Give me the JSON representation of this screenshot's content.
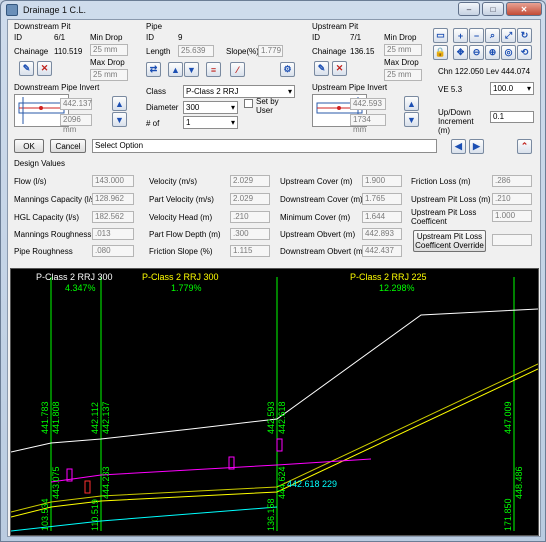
{
  "window": {
    "title": "Drainage 1 C.L."
  },
  "downstream_pit": {
    "heading": "Downstream Pit",
    "id_label": "ID",
    "id_value": "6/1",
    "chainage_label": "Chainage",
    "chainage_value": "110.519",
    "min_drop_label": "Min Drop",
    "min_drop_value": "25 mm",
    "max_drop_label": "Max Drop",
    "max_drop_value": "25 mm",
    "invert_heading": "Downstream Pipe Invert",
    "invert_value": "442.137",
    "invert_mm": "2096 mm"
  },
  "pipe": {
    "heading": "Pipe",
    "id_label": "ID",
    "id_value": "9",
    "length_label": "Length",
    "length_value": "25.639",
    "slope_label": "Slope(%)",
    "slope_value": "1.779",
    "class_label": "Class",
    "class_value": "P-Class 2 RRJ",
    "diameter_label": "Diameter",
    "diameter_value": "300",
    "setby_label": "Set by User",
    "count_label": "# of",
    "count_value": "1"
  },
  "upstream_pit": {
    "heading": "Upstream Pit",
    "id_label": "ID",
    "id_value": "7/1",
    "chainage_label": "Chainage",
    "chainage_value": "136.15",
    "min_drop_label": "Min Drop",
    "min_drop_value": "25 mm",
    "max_drop_label": "Max Drop",
    "max_drop_value": "25 mm",
    "invert_heading": "Upstream Pipe Invert",
    "invert_value": "442.593",
    "invert_mm": "1734 mm"
  },
  "view": {
    "chn_lev": "Chn 122.050 Lev 444.074",
    "ve_label": "VE 5.3",
    "ve_value": "100.0",
    "updown_label": "Up/Down Increment (m)",
    "updown_value": "0.1"
  },
  "actions": {
    "ok": "OK",
    "cancel": "Cancel",
    "select_option": "Select Option"
  },
  "design": {
    "heading": "Design Values",
    "col1": [
      {
        "label": "Flow (l/s)",
        "value": "143.000"
      },
      {
        "label": "Mannings Capacity (l/s)",
        "value": "128.962"
      },
      {
        "label": "HGL Capacity (l/s)",
        "value": "182.562"
      },
      {
        "label": "Mannings Roughness",
        "value": ".013"
      },
      {
        "label": "Pipe Roughness",
        "value": ".080"
      }
    ],
    "col2": [
      {
        "label": "Velocity (m/s)",
        "value": "2.029"
      },
      {
        "label": "Part Velocity (m/s)",
        "value": "2.029"
      },
      {
        "label": "Velocity Head (m)",
        "value": ".210"
      },
      {
        "label": "Part Flow Depth (m)",
        "value": ".300"
      },
      {
        "label": "Friction Slope (%)",
        "value": "1.115"
      }
    ],
    "col3": [
      {
        "label": "Upstream Cover (m)",
        "value": "1.900"
      },
      {
        "label": "Downstream Cover (m)",
        "value": "1.765"
      },
      {
        "label": "Minimum Cover (m)",
        "value": "1.644"
      },
      {
        "label": "Upstream Obvert (m)",
        "value": "442.893"
      },
      {
        "label": "Downstream Obvert (m)",
        "value": "442.437"
      }
    ],
    "col4": [
      {
        "label": "Friction Loss (m)",
        "value": ".286"
      },
      {
        "label": "Upstream Pit Loss (m)",
        "value": ".210"
      },
      {
        "label": "Upstream Pit Loss Coefficent",
        "value": "1.000"
      }
    ],
    "override_button": "Upstream Pit Loss Coefficent Override",
    "override_value": ""
  },
  "profile": {
    "pipes": [
      {
        "name": "P-Class 2 RRJ 300",
        "slope": "4.347%",
        "color": "#ffffff"
      },
      {
        "name": "P-Class 2 RRJ 300",
        "slope": "1.779%",
        "color": "#ffff00"
      },
      {
        "name": "P-Class 2 RRJ 225",
        "slope": "12.298%",
        "color": "#ffff00"
      }
    ],
    "verticals": [
      {
        "top": "441.783",
        "top2": "441.808",
        "bottom": "443.075",
        "chainage": "103.534"
      },
      {
        "top": "442.112",
        "top2": "442.137",
        "bottom": "444.233",
        "chainage": "110.519"
      },
      {
        "top": "442.593",
        "top2": "442.618",
        "bottom": "444.624",
        "chainage": "136.158"
      },
      {
        "top": "447.009",
        "top2": "",
        "bottom": "448.486",
        "chainage": "171.850"
      }
    ],
    "cursor_label": "442.618 229",
    "colors": {
      "ground": "#ffffff",
      "pipe": "#ffff00",
      "hgl": "#ff00ff",
      "obvert": "#00ffff",
      "label": "#00ff00"
    }
  }
}
